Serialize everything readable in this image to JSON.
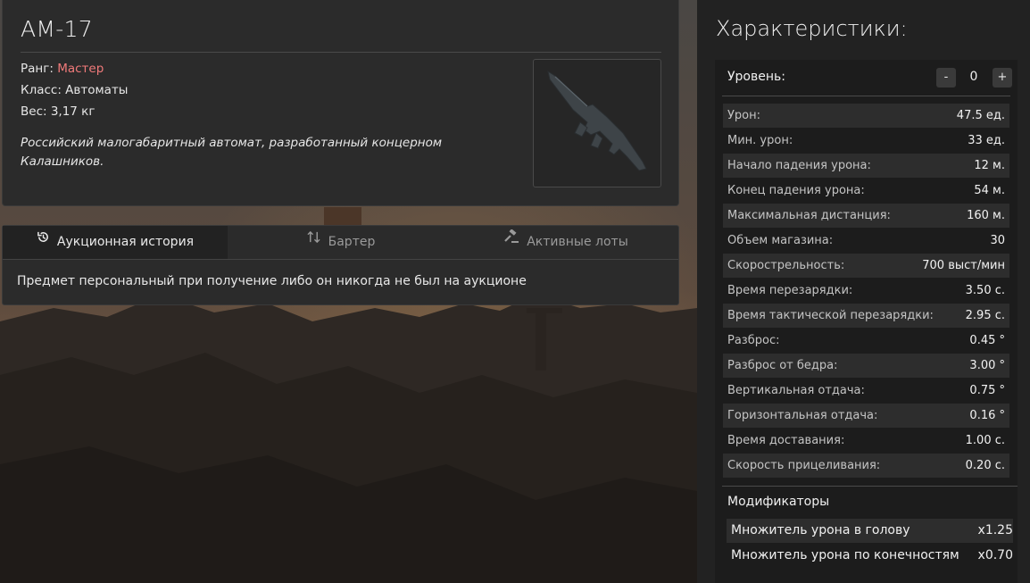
{
  "item": {
    "title": "АМ-17",
    "rank_label": "Ранг:",
    "rank_value": "Мастер",
    "class_text": "Класс: Автоматы",
    "weight_text": "Вес: 3,17 кг",
    "description": "Российский малогабаритный автомат, разработанный концерном Калашников."
  },
  "tabs": [
    {
      "label": "Аукционная история",
      "icon": "history-icon",
      "active": true
    },
    {
      "label": "Бартер",
      "icon": "swap-arrows-icon",
      "active": false
    },
    {
      "label": "Активные лоты",
      "icon": "gavel-icon",
      "active": false
    }
  ],
  "tab_note": "Предмет персональный при получение либо он никогда не был на аукционе",
  "stats": {
    "heading": "Характеристики:",
    "level_label": "Уровень:",
    "level_value": "0",
    "minus": "-",
    "plus": "+",
    "rows": [
      {
        "label": "Урон:",
        "value": "47.5 ед."
      },
      {
        "label": "Мин. урон:",
        "value": "33 ед."
      },
      {
        "label": "Начало падения урона:",
        "value": "12 м."
      },
      {
        "label": "Конец падения урона:",
        "value": "54 м."
      },
      {
        "label": "Максимальная дистанция:",
        "value": "160 м."
      },
      {
        "label": "Объем магазина:",
        "value": "30"
      },
      {
        "label": "Скорострельность:",
        "value": "700 выст/мин"
      },
      {
        "label": "Время перезарядки:",
        "value": "3.50 с."
      },
      {
        "label": "Время тактической перезарядки:",
        "value": "2.95 с."
      },
      {
        "label": "Разброс:",
        "value": "0.45 °"
      },
      {
        "label": "Разброс от бедра:",
        "value": "3.00 °"
      },
      {
        "label": "Вертикальная отдача:",
        "value": "0.75 °"
      },
      {
        "label": "Горизонтальная отдача:",
        "value": "0.16 °"
      },
      {
        "label": "Время доставания:",
        "value": "1.00 с."
      },
      {
        "label": "Скорость прицеливания:",
        "value": "0.20 с."
      }
    ],
    "modifiers_title": "Модификаторы",
    "modifiers": [
      {
        "label": "Множитель урона в голову",
        "value": "x1.25"
      },
      {
        "label": "Множитель урона по конечностям",
        "value": "x0.70"
      }
    ]
  },
  "colors": {
    "rank": "#f07a7a",
    "panel": "#222222",
    "row_alt": "#2d2d2d"
  }
}
